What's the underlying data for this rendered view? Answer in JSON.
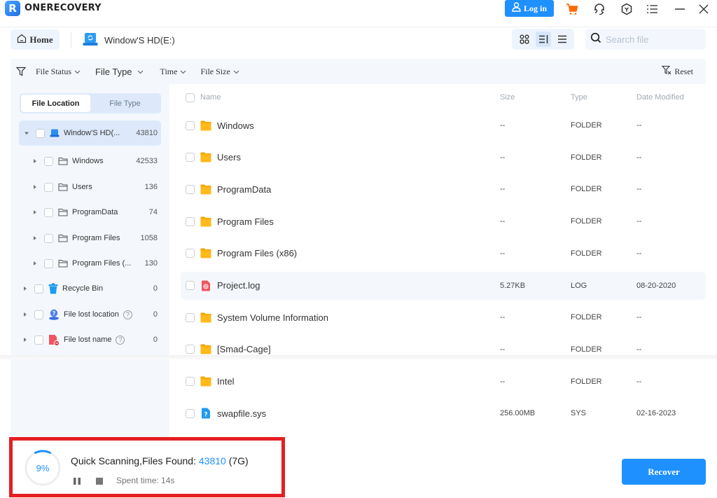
{
  "app": {
    "name": "ONERECOVERY",
    "logo_letter": "R",
    "login_label": "Log in"
  },
  "colors": {
    "accent": "#1e90ff",
    "cart": "#ff6a00",
    "highlight_border": "#e51e22",
    "folder": "#ffb400",
    "panel_bg": "#f4f8fd"
  },
  "titlebar_icons": [
    "user-icon",
    "cart-icon",
    "headset-icon",
    "hexagon-badge-icon",
    "menu-list-icon",
    "minimize-icon",
    "close-icon"
  ],
  "nav": {
    "home_label": "Home",
    "drive_label": "Window'S HD(E:)",
    "search_placeholder": "Search file",
    "search_value": "",
    "view_modes": [
      "grid-view",
      "detail-view",
      "list-view"
    ],
    "active_view": "detail-view"
  },
  "filters": {
    "file_status": "File Status",
    "file_type": "File Type",
    "time": "Time",
    "file_size": "File Size",
    "reset": "Reset"
  },
  "sidebar": {
    "tabs": [
      {
        "label": "File Location",
        "active": true
      },
      {
        "label": "File Type",
        "active": false
      }
    ],
    "tree": [
      {
        "label": "Window'S HD(...",
        "count": "43810",
        "icon": "drive-icon",
        "level": 0,
        "expanded": true,
        "selected": true
      },
      {
        "label": "Windows",
        "count": "42533",
        "icon": "folder-outline-icon",
        "level": 1
      },
      {
        "label": "Users",
        "count": "136",
        "icon": "folder-outline-icon",
        "level": 1
      },
      {
        "label": "ProgramData",
        "count": "74",
        "icon": "folder-outline-icon",
        "level": 1
      },
      {
        "label": "Program Files",
        "count": "1058",
        "icon": "folder-outline-icon",
        "level": 1
      },
      {
        "label": "Program Files (...",
        "count": "130",
        "icon": "folder-outline-icon",
        "level": 1
      },
      {
        "label": "Recycle Bin",
        "count": "0",
        "icon": "recycle-bin-icon",
        "level": 0
      },
      {
        "label": "File lost location",
        "count": "0",
        "icon": "lost-location-icon",
        "level": 0,
        "help": true
      },
      {
        "label": "File lost name",
        "count": "0",
        "icon": "lost-name-icon",
        "level": 0,
        "help": true
      }
    ]
  },
  "table": {
    "headers": {
      "name": "Name",
      "size": "Size",
      "type": "Type",
      "date": "Date Modified"
    },
    "rows": [
      {
        "name": "Windows",
        "size": "--",
        "type": "FOLDER",
        "date": "--",
        "icon": "folder"
      },
      {
        "name": "Users",
        "size": "--",
        "type": "FOLDER",
        "date": "--",
        "icon": "folder"
      },
      {
        "name": "ProgramData",
        "size": "--",
        "type": "FOLDER",
        "date": "--",
        "icon": "folder"
      },
      {
        "name": "Program Files",
        "size": "--",
        "type": "FOLDER",
        "date": "--",
        "icon": "folder"
      },
      {
        "name": "Program Files (x86)",
        "size": "--",
        "type": "FOLDER",
        "date": "--",
        "icon": "folder"
      },
      {
        "name": "Project.log",
        "size": "5.27KB",
        "type": "LOG",
        "date": "08-20-2020",
        "icon": "log",
        "hover": true
      },
      {
        "name": "System Volume Information",
        "size": "--",
        "type": "FOLDER",
        "date": "--",
        "icon": "folder"
      },
      {
        "name": "[Smad-Cage]",
        "size": "--",
        "type": "FOLDER",
        "date": "--",
        "icon": "folder"
      },
      {
        "name": "Intel",
        "size": "--",
        "type": "FOLDER",
        "date": "--",
        "icon": "folder"
      },
      {
        "name": "swapfile.sys",
        "size": "256.00MB",
        "type": "SYS",
        "date": "02-16-2023",
        "icon": "unknown"
      }
    ]
  },
  "scan": {
    "progress_percent": 9,
    "progress_label": "9%",
    "title": "Quick Scanning,Files Found:",
    "files_found": "43810",
    "total_size": "(7G)",
    "spent_time": "Spent time: 14s"
  },
  "recover_label": "Recover"
}
